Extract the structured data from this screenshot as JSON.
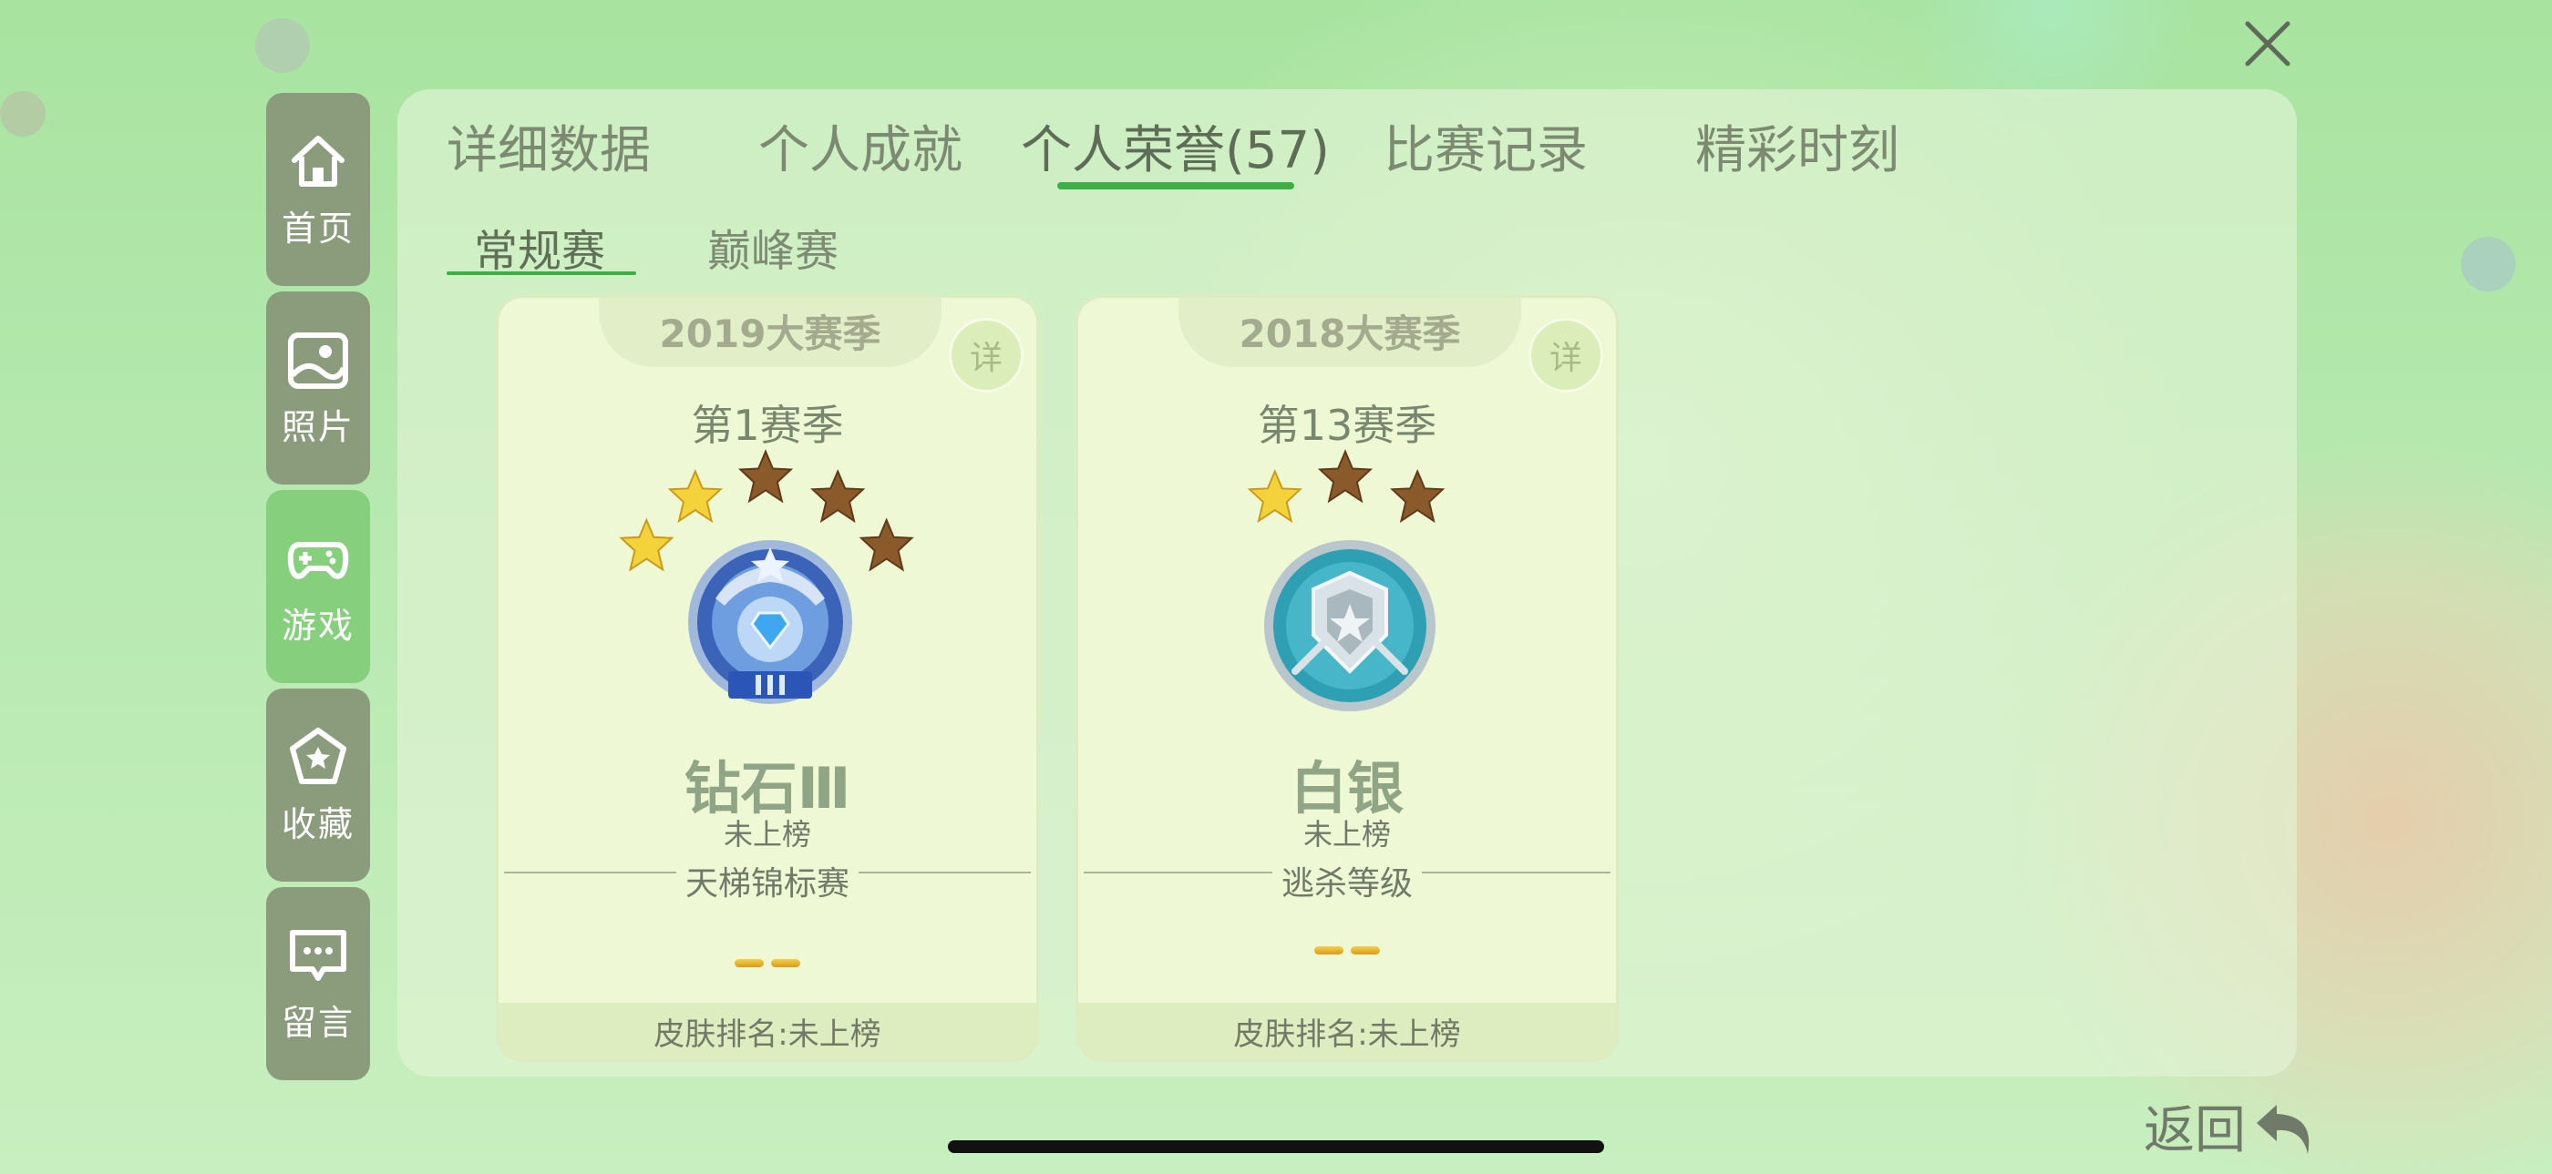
{
  "sidebar": {
    "items": [
      {
        "label": "首页",
        "icon": "home-icon",
        "active": false
      },
      {
        "label": "照片",
        "icon": "photo-icon",
        "active": false
      },
      {
        "label": "游戏",
        "icon": "gamepad-icon",
        "active": true
      },
      {
        "label": "收藏",
        "icon": "star-icon",
        "active": false
      },
      {
        "label": "留言",
        "icon": "message-icon",
        "active": false
      }
    ]
  },
  "tabs": [
    {
      "label": "详细数据",
      "active": false
    },
    {
      "label": "个人成就",
      "active": false
    },
    {
      "label": "个人荣誉(57)",
      "active": true
    },
    {
      "label": "比赛记录",
      "active": false
    },
    {
      "label": "精彩时刻",
      "active": false
    }
  ],
  "subtabs": [
    {
      "label": "常规赛",
      "active": true
    },
    {
      "label": "巅峰赛",
      "active": false
    }
  ],
  "cards": [
    {
      "season_year": "2019大赛季",
      "detail_label": "详",
      "season": "第1赛季",
      "stars_total": 5,
      "stars_gold": 2,
      "badge": "diamond-rank-badge",
      "rank": "钻石Ⅲ",
      "rank_status": "未上榜",
      "mode": "天梯锦标赛",
      "skin_rank": "皮肤排名:未上榜"
    },
    {
      "season_year": "2018大赛季",
      "detail_label": "详",
      "season": "第13赛季",
      "stars_total": 3,
      "stars_gold": 1,
      "badge": "silver-rank-badge",
      "rank": "白银",
      "rank_status": "未上榜",
      "mode": "逃杀等级",
      "skin_rank": "皮肤排名:未上榜"
    }
  ],
  "back": {
    "label": "返回",
    "icon": "back-arrow-icon"
  },
  "colors": {
    "accent_green": "#3fae48",
    "sidebar_bg": "#8a9c7c",
    "sidebar_active_bg": "#86cf7c",
    "star_gold": "#f1d23a",
    "star_bronze": "#8b5a2b"
  }
}
